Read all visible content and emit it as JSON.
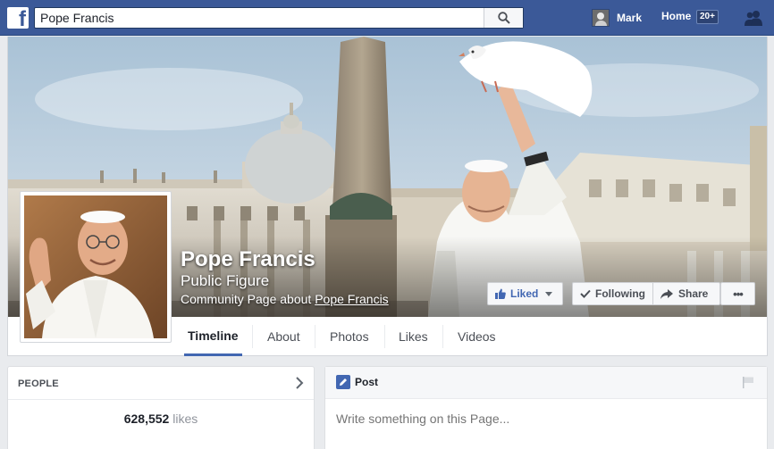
{
  "topbar": {
    "logo": "f",
    "search_value": "Pope Francis",
    "search_icon": "magnifier-icon",
    "user_name": "Mark",
    "home_label": "Home",
    "home_badge": "20+",
    "friends_icon": "friend-requests-icon"
  },
  "page": {
    "name": "Pope Francis",
    "category": "Public Figure",
    "community_prefix": "Community Page about ",
    "community_link": "Pope Francis"
  },
  "actions": {
    "liked": "Liked",
    "following": "Following",
    "share": "Share",
    "more": "•••"
  },
  "nav": {
    "tabs": [
      {
        "label": "Timeline",
        "active": true
      },
      {
        "label": "About"
      },
      {
        "label": "Photos"
      },
      {
        "label": "Likes"
      },
      {
        "label": "Videos"
      }
    ]
  },
  "people": {
    "title": "PEOPLE",
    "likes_count": "628,552",
    "likes_label": "likes"
  },
  "composer": {
    "tab_label": "Post",
    "placeholder": "Write something on this Page..."
  },
  "colors": {
    "facebook_blue": "#3b5998",
    "accent": "#4267b2"
  }
}
